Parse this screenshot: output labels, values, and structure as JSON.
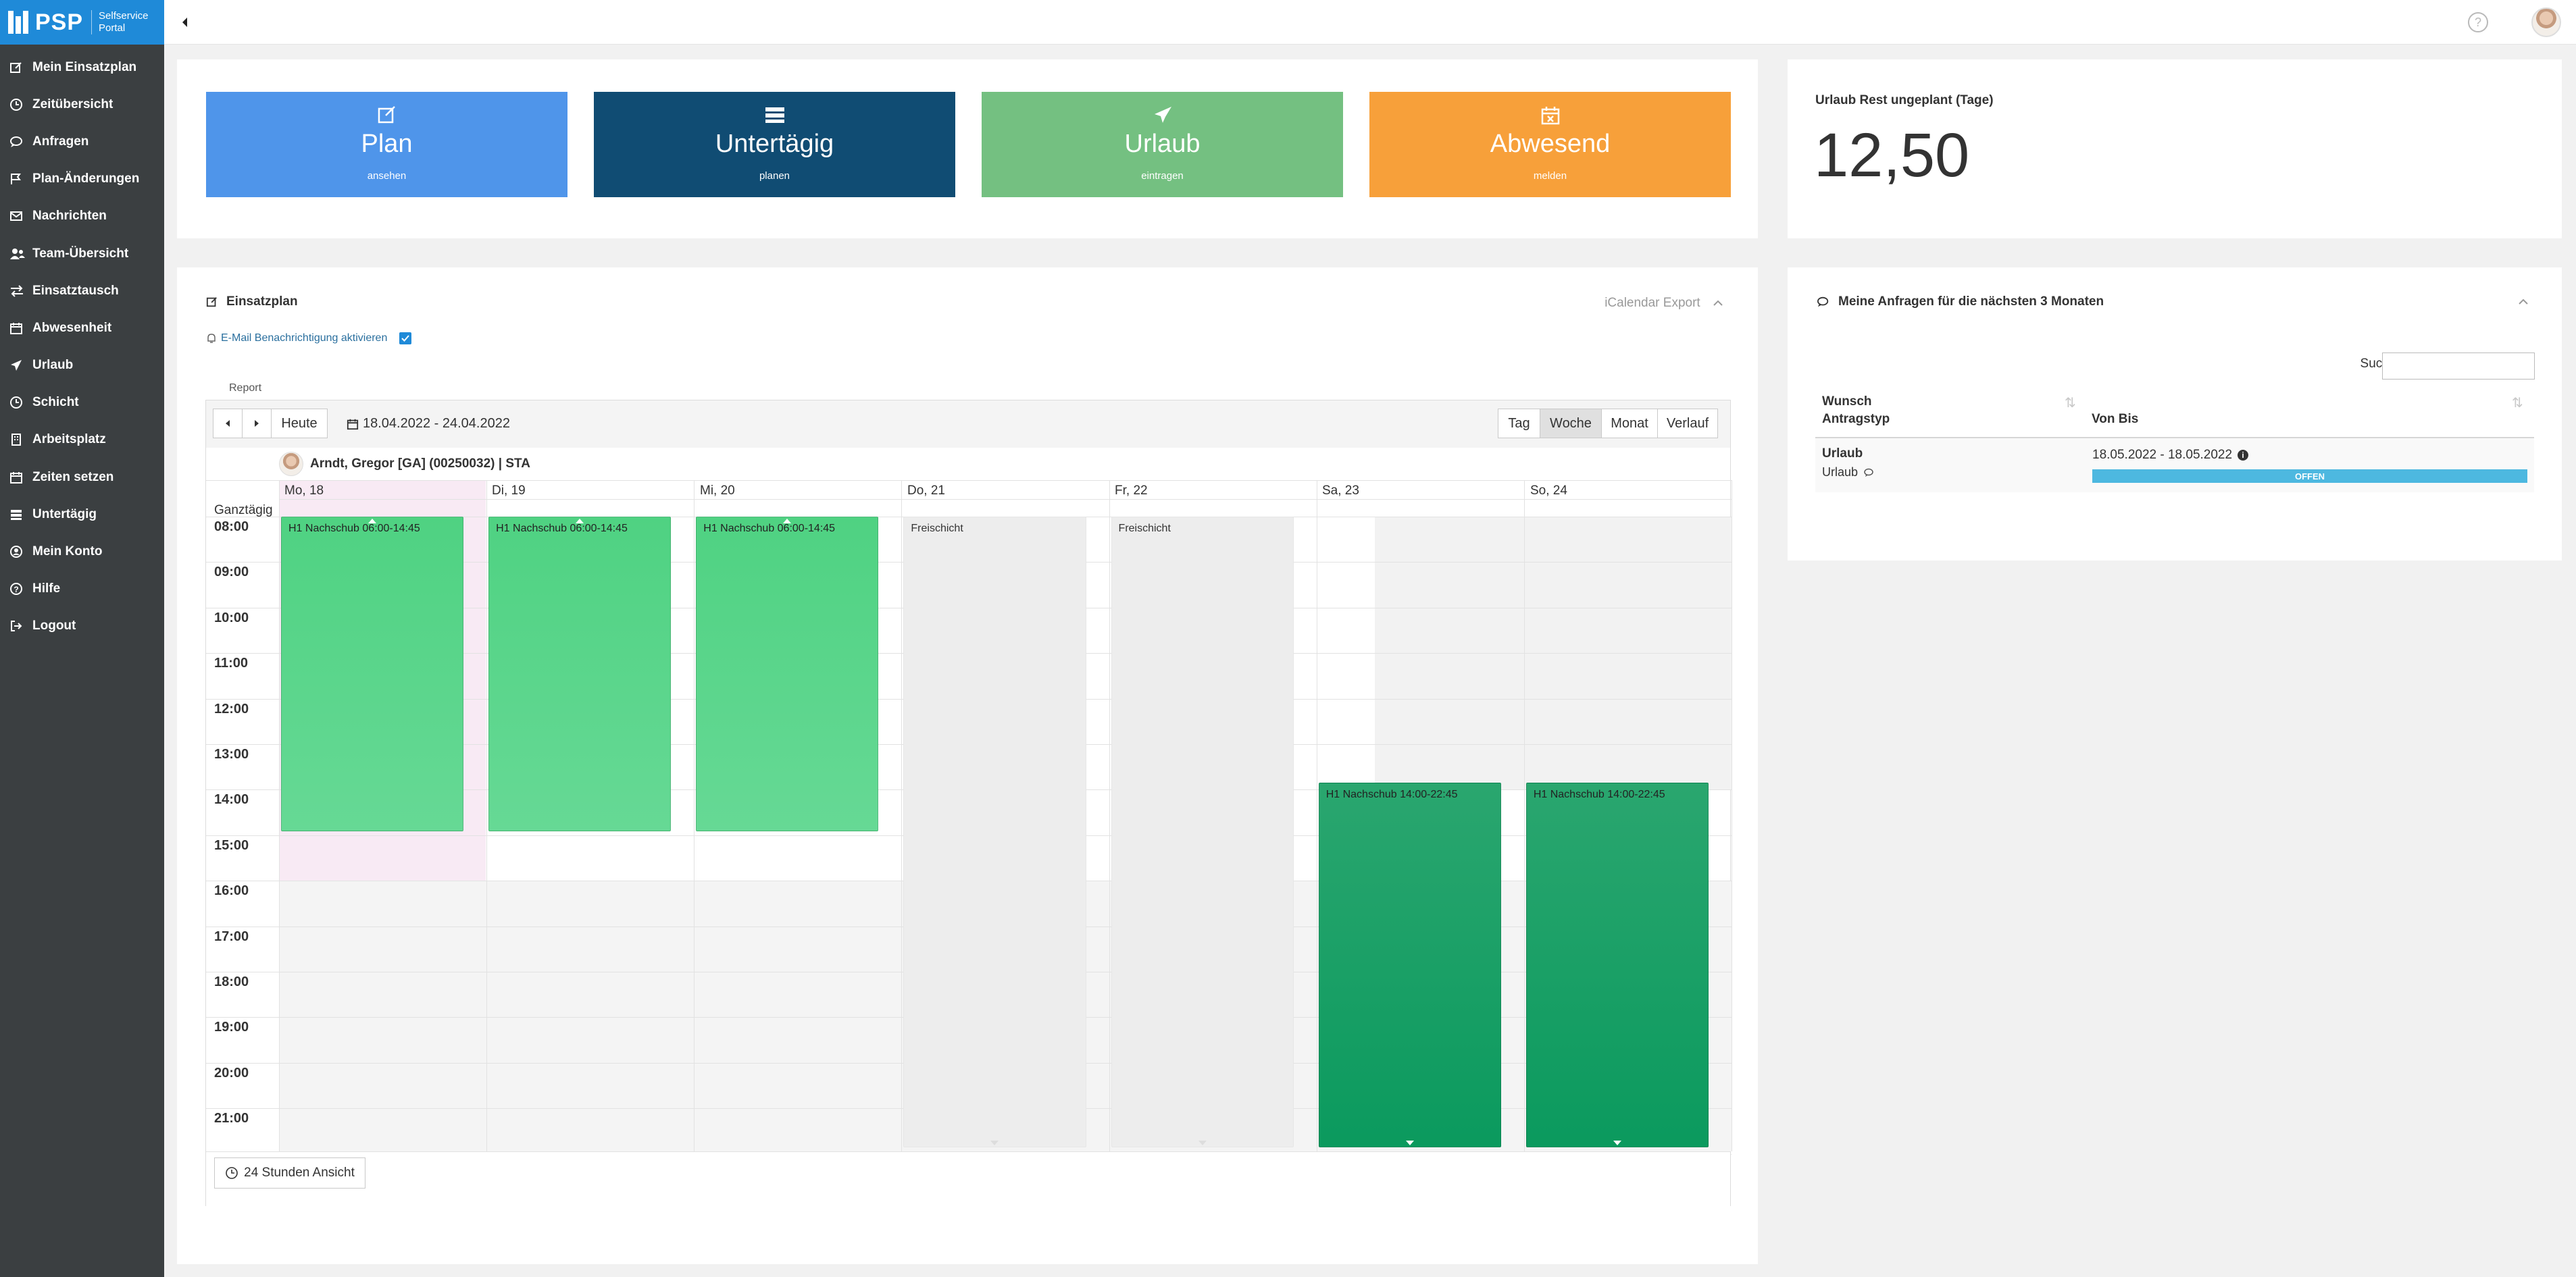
{
  "brand": {
    "name": "PSP",
    "sub_line1": "Selfservice",
    "sub_line2": "Portal"
  },
  "sidebar": {
    "items": [
      {
        "label": "Mein Einsatzplan",
        "icon": "edit-icon"
      },
      {
        "label": "Zeitübersicht",
        "icon": "clock-icon"
      },
      {
        "label": "Anfragen",
        "icon": "chat-icon"
      },
      {
        "label": "Plan-Änderungen",
        "icon": "flag-icon"
      },
      {
        "label": "Nachrichten",
        "icon": "mail-icon"
      },
      {
        "label": "Team-Übersicht",
        "icon": "users-icon"
      },
      {
        "label": "Einsatztausch",
        "icon": "exchange-icon"
      },
      {
        "label": "Abwesenheit",
        "icon": "calendar-icon"
      },
      {
        "label": "Urlaub",
        "icon": "plane-icon"
      },
      {
        "label": "Schicht",
        "icon": "clock-icon"
      },
      {
        "label": "Arbeitsplatz",
        "icon": "building-icon"
      },
      {
        "label": "Zeiten setzen",
        "icon": "calendar-icon"
      },
      {
        "label": "Untertägig",
        "icon": "server-icon"
      },
      {
        "label": "Mein Konto",
        "icon": "user-circle-icon"
      },
      {
        "label": "Hilfe",
        "icon": "help-icon"
      },
      {
        "label": "Logout",
        "icon": "logout-icon"
      }
    ]
  },
  "topbar": {
    "help": "?"
  },
  "tiles": [
    {
      "label": "Plan",
      "sub": "ansehen",
      "color": "#4f95ea",
      "icon": "edit-icon"
    },
    {
      "label": "Untertägig",
      "sub": "planen",
      "color": "#104c73",
      "icon": "server-icon"
    },
    {
      "label": "Urlaub",
      "sub": "eintragen",
      "color": "#74c081",
      "icon": "plane-icon"
    },
    {
      "label": "Abwesend",
      "sub": "melden",
      "color": "#f7a03a",
      "icon": "calendar-x-icon"
    }
  ],
  "urlaub_rest": {
    "label": "Urlaub Rest ungeplant (Tage)",
    "value": "12,50"
  },
  "plan": {
    "title": "Einsatzplan",
    "ical_export": "iCalendar Export",
    "email_notify": "E-Mail Benachrichtigung aktivieren",
    "report": "Report",
    "today": "Heute",
    "date_range": "18.04.2022 - 24.04.2022",
    "views": [
      "Tag",
      "Woche",
      "Monat",
      "Verlauf"
    ],
    "active_view": "Woche",
    "employee": "Arndt, Gregor [GA] (00250032) | STA",
    "allday": "Ganztägig",
    "days": [
      "Mo, 18",
      "Di, 19",
      "Mi, 20",
      "Do, 21",
      "Fr, 22",
      "Sa, 23",
      "So, 24"
    ],
    "times": [
      "08:00",
      "09:00",
      "10:00",
      "11:00",
      "12:00",
      "13:00",
      "14:00",
      "15:00",
      "16:00",
      "17:00",
      "18:00",
      "19:00",
      "20:00",
      "21:00"
    ],
    "events": [
      {
        "day": 0,
        "label": "H1 Nachschub 06:00-14:45",
        "type": "am"
      },
      {
        "day": 1,
        "label": "H1 Nachschub 06:00-14:45",
        "type": "am"
      },
      {
        "day": 2,
        "label": "H1 Nachschub 06:00-14:45",
        "type": "am"
      },
      {
        "day": 3,
        "label": "Freischicht",
        "type": "free"
      },
      {
        "day": 4,
        "label": "Freischicht",
        "type": "free"
      },
      {
        "day": 5,
        "label": "H1 Nachschub 14:00-22:45",
        "type": "pm"
      },
      {
        "day": 6,
        "label": "H1 Nachschub 14:00-22:45",
        "type": "pm"
      }
    ],
    "footer_button": "24 Stunden Ansicht"
  },
  "requests": {
    "title": "Meine Anfragen für die nächsten 3 Monaten",
    "search_label": "Suchen",
    "search_value": "",
    "col1_line1": "Wunsch",
    "col1_line2": "Antragstyp",
    "col2": "Von Bis",
    "rows": [
      {
        "wunsch": "Urlaub",
        "typ": "Urlaub",
        "von_bis": "18.05.2022 - 18.05.2022",
        "status": "OFFEN",
        "status_color": "#4db8e0"
      }
    ]
  }
}
